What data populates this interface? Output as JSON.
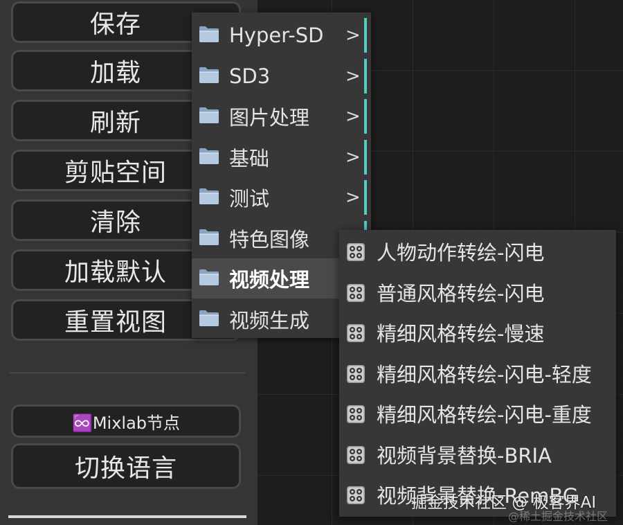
{
  "side_menu": {
    "buttons": [
      {
        "label": "保存"
      },
      {
        "label": "加载"
      },
      {
        "label": "刷新"
      },
      {
        "label": "剪贴空间"
      },
      {
        "label": "清除"
      },
      {
        "label": "加载默认"
      },
      {
        "label": "重置视图"
      }
    ],
    "mixlab_label": "♾️Mixlab节点",
    "language_label": "切换语言"
  },
  "context_menu": {
    "items": [
      {
        "label": "Hyper-SD",
        "arrow": ">",
        "icon": "folder-icon"
      },
      {
        "label": "SD3",
        "arrow": ">",
        "icon": "folder-icon"
      },
      {
        "label": "图片处理",
        "arrow": ">",
        "icon": "folder-icon"
      },
      {
        "label": "基础",
        "arrow": ">",
        "icon": "folder-icon"
      },
      {
        "label": "测试",
        "arrow": ">",
        "icon": "folder-icon"
      },
      {
        "label": "特色图像",
        "arrow": ">",
        "icon": "folder-icon"
      },
      {
        "label": "视频处理",
        "arrow": "",
        "icon": "folder-icon",
        "active": true
      },
      {
        "label": "视频生成",
        "arrow": "",
        "icon": "folder-icon"
      }
    ]
  },
  "submenu": {
    "items": [
      {
        "label": "人物动作转绘-闪电",
        "icon": "node-icon"
      },
      {
        "label": "普通风格转绘-闪电",
        "icon": "node-icon"
      },
      {
        "label": "精细风格转绘-慢速",
        "icon": "node-icon"
      },
      {
        "label": "精细风格转绘-闪电-轻度",
        "icon": "node-icon"
      },
      {
        "label": "精细风格转绘-闪电-重度",
        "icon": "node-icon"
      },
      {
        "label": "视频背景替换-BRIA",
        "icon": "node-icon"
      },
      {
        "label": "视频背景替换-RemBG",
        "icon": "node-icon"
      }
    ]
  },
  "watermark": {
    "text": "掘金技术社区 @ 极客界AI",
    "subtext": "@稀土掘金技术社区"
  },
  "colors": {
    "accent": "#4ecdc4",
    "panel": "#353535",
    "button_bg": "#222222",
    "menu_bg": "#373737"
  }
}
